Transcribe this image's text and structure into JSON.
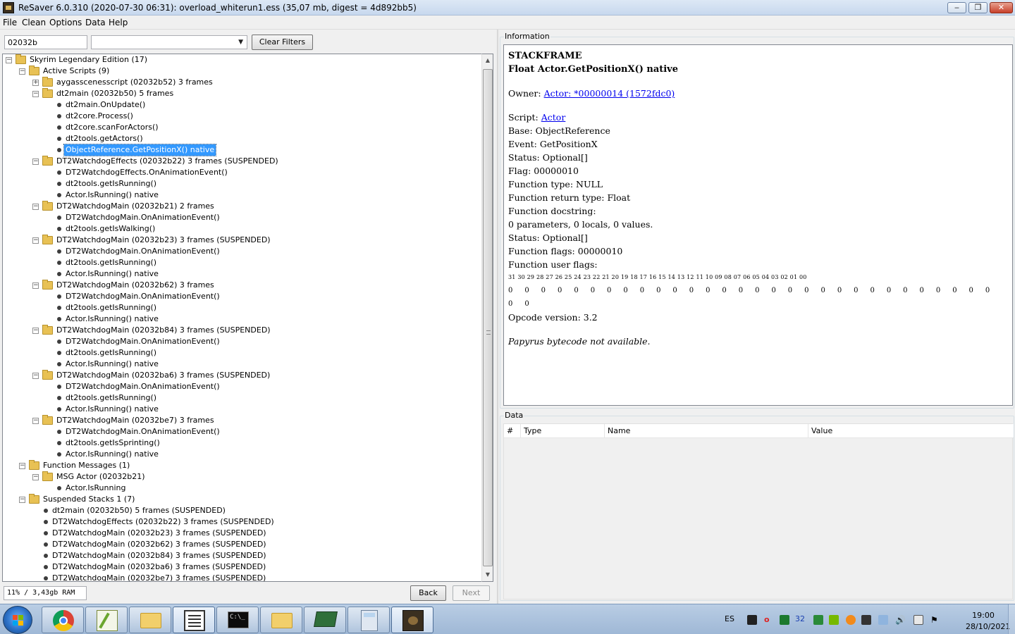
{
  "window": {
    "title": "ReSaver 6.0.310 (2020-07-30 06:31): overload_whiterun1.ess (35,07 mb, digest = 4d892bb5)",
    "min_glyph": "‒",
    "max_glyph": "❐",
    "close_glyph": "✕"
  },
  "menu": {
    "file": "File",
    "clean": "Clean",
    "options": "Options",
    "data": "Data",
    "help": "Help"
  },
  "filter": {
    "value": "02032b",
    "select_value": "",
    "clear_label": "Clear Filters"
  },
  "tree": [
    {
      "label": "Skyrim Legendary Edition (17)",
      "level": 0,
      "kind": "folder",
      "expander": "−"
    },
    {
      "label": "Active Scripts (9)",
      "level": 1,
      "kind": "folder",
      "expander": "−"
    },
    {
      "label": "aygasscenesscript (02032b52) 3 frames",
      "level": 2,
      "kind": "folder",
      "expander": "+"
    },
    {
      "label": "dt2main (02032b50) 5 frames",
      "level": 2,
      "kind": "folder",
      "expander": "−"
    },
    {
      "label": "dt2main.OnUpdate()",
      "level": 3,
      "kind": "leaf"
    },
    {
      "label": "dt2core.Process()",
      "level": 3,
      "kind": "leaf"
    },
    {
      "label": "dt2core.scanForActors()",
      "level": 3,
      "kind": "leaf"
    },
    {
      "label": "dt2tools.getActors()",
      "level": 3,
      "kind": "leaf"
    },
    {
      "label": "ObjectReference.GetPositionX() native",
      "level": 3,
      "kind": "leaf",
      "selected": true
    },
    {
      "label": "DT2WatchdogEffects (02032b22) 3 frames (SUSPENDED)",
      "level": 2,
      "kind": "folder",
      "expander": "−"
    },
    {
      "label": "DT2WatchdogEffects.OnAnimationEvent()",
      "level": 3,
      "kind": "leaf"
    },
    {
      "label": "dt2tools.getIsRunning()",
      "level": 3,
      "kind": "leaf"
    },
    {
      "label": "Actor.IsRunning() native",
      "level": 3,
      "kind": "leaf"
    },
    {
      "label": "DT2WatchdogMain (02032b21) 2 frames",
      "level": 2,
      "kind": "folder",
      "expander": "−"
    },
    {
      "label": "DT2WatchdogMain.OnAnimationEvent()",
      "level": 3,
      "kind": "leaf"
    },
    {
      "label": "dt2tools.getIsWalking()",
      "level": 3,
      "kind": "leaf"
    },
    {
      "label": "DT2WatchdogMain (02032b23) 3 frames (SUSPENDED)",
      "level": 2,
      "kind": "folder",
      "expander": "−"
    },
    {
      "label": "DT2WatchdogMain.OnAnimationEvent()",
      "level": 3,
      "kind": "leaf"
    },
    {
      "label": "dt2tools.getIsRunning()",
      "level": 3,
      "kind": "leaf"
    },
    {
      "label": "Actor.IsRunning() native",
      "level": 3,
      "kind": "leaf"
    },
    {
      "label": "DT2WatchdogMain (02032b62) 3 frames",
      "level": 2,
      "kind": "folder",
      "expander": "−"
    },
    {
      "label": "DT2WatchdogMain.OnAnimationEvent()",
      "level": 3,
      "kind": "leaf"
    },
    {
      "label": "dt2tools.getIsRunning()",
      "level": 3,
      "kind": "leaf"
    },
    {
      "label": "Actor.IsRunning() native",
      "level": 3,
      "kind": "leaf"
    },
    {
      "label": "DT2WatchdogMain (02032b84) 3 frames (SUSPENDED)",
      "level": 2,
      "kind": "folder",
      "expander": "−"
    },
    {
      "label": "DT2WatchdogMain.OnAnimationEvent()",
      "level": 3,
      "kind": "leaf"
    },
    {
      "label": "dt2tools.getIsRunning()",
      "level": 3,
      "kind": "leaf"
    },
    {
      "label": "Actor.IsRunning() native",
      "level": 3,
      "kind": "leaf"
    },
    {
      "label": "DT2WatchdogMain (02032ba6) 3 frames (SUSPENDED)",
      "level": 2,
      "kind": "folder",
      "expander": "−"
    },
    {
      "label": "DT2WatchdogMain.OnAnimationEvent()",
      "level": 3,
      "kind": "leaf"
    },
    {
      "label": "dt2tools.getIsRunning()",
      "level": 3,
      "kind": "leaf"
    },
    {
      "label": "Actor.IsRunning() native",
      "level": 3,
      "kind": "leaf"
    },
    {
      "label": "DT2WatchdogMain (02032be7) 3 frames",
      "level": 2,
      "kind": "folder",
      "expander": "−"
    },
    {
      "label": "DT2WatchdogMain.OnAnimationEvent()",
      "level": 3,
      "kind": "leaf"
    },
    {
      "label": "dt2tools.getIsSprinting()",
      "level": 3,
      "kind": "leaf"
    },
    {
      "label": "Actor.IsRunning() native",
      "level": 3,
      "kind": "leaf"
    },
    {
      "label": "Function Messages (1)",
      "level": 1,
      "kind": "folder",
      "expander": "−"
    },
    {
      "label": "MSG Actor (02032b21)",
      "level": 2,
      "kind": "folder",
      "expander": "−"
    },
    {
      "label": "Actor.IsRunning",
      "level": 3,
      "kind": "leaf"
    },
    {
      "label": "Suspended Stacks 1 (7)",
      "level": 1,
      "kind": "folder",
      "expander": "−"
    },
    {
      "label": "dt2main (02032b50) 5 frames (SUSPENDED)",
      "level": 2,
      "kind": "leaf"
    },
    {
      "label": "DT2WatchdogEffects (02032b22) 3 frames (SUSPENDED)",
      "level": 2,
      "kind": "leaf"
    },
    {
      "label": "DT2WatchdogMain (02032b23) 3 frames (SUSPENDED)",
      "level": 2,
      "kind": "leaf"
    },
    {
      "label": "DT2WatchdogMain (02032b62) 3 frames (SUSPENDED)",
      "level": 2,
      "kind": "leaf"
    },
    {
      "label": "DT2WatchdogMain (02032b84) 3 frames (SUSPENDED)",
      "level": 2,
      "kind": "leaf"
    },
    {
      "label": "DT2WatchdogMain (02032ba6) 3 frames (SUSPENDED)",
      "level": 2,
      "kind": "leaf"
    },
    {
      "label": "DT2WatchdogMain (02032be7) 3 frames (SUSPENDED)",
      "level": 2,
      "kind": "leaf"
    }
  ],
  "status": {
    "ram": "11% / 3,43gb RAM",
    "back": "Back",
    "next": "Next"
  },
  "info": {
    "legend": "Information",
    "heading1": "STACKFRAME",
    "heading2": "Float Actor.GetPositionX() native",
    "owner_label": "Owner: ",
    "owner_link": "Actor: *00000014 (1572fdc0)",
    "script_label": "Script: ",
    "script_link": "Actor",
    "base": "Base: ObjectReference",
    "event": "Event: GetPositionX",
    "status": "Status: Optional[]",
    "flag": "Flag: 00000010",
    "function_type": "Function type: NULL",
    "function_return_type": "Function return type: Float",
    "function_docstring": "Function docstring:",
    "counts": "0 parameters, 0 locals, 0 values.",
    "status2": "Status: Optional[]",
    "function_flags": "Function flags: 00000010",
    "function_user_flags": "Function user flags:",
    "bit_labels": "31 30 29 28 27 26 25 24 23 22 21 20 19 18 17 16 15 14 13 12 11 10 09 08 07 06 05 04 03 02 01 00",
    "bit_values": "0 0 0 0 0 0 0 0 0 0 0 0 0 0 0 0 0 0 0 0 0 0 0 0 0 0 0 0 0 0 0 0",
    "opcode": "Opcode version: 3.2",
    "bytecode": "Papyrus bytecode not available."
  },
  "data_panel": {
    "legend": "Data",
    "columns": [
      "#",
      "Type",
      "Name",
      "Value"
    ]
  },
  "taskbar": {
    "apps": [
      "start-menu",
      "chrome",
      "notepad-plus-plus",
      "file-explorer",
      "notepad",
      "command-prompt",
      "file-explorer",
      "network-monitor",
      "calculator",
      "resaver"
    ],
    "language": "ES",
    "tray_number": "32",
    "time": "19:00",
    "date": "28/10/2021"
  }
}
